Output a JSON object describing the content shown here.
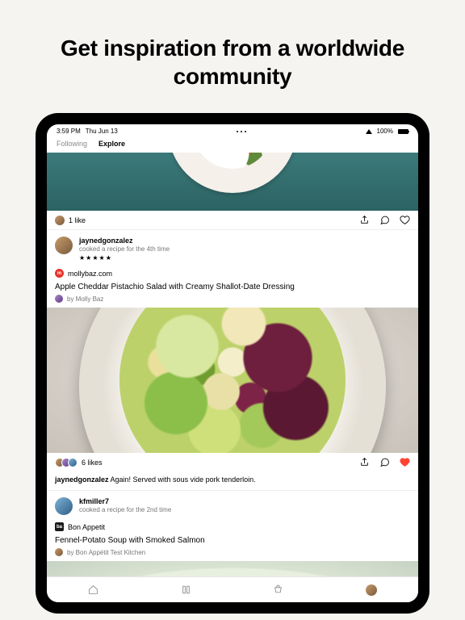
{
  "headline": "Get inspiration from a worldwide community",
  "statusbar": {
    "time": "3:59 PM",
    "date": "Thu Jun 13",
    "battery": "100%"
  },
  "tabs": {
    "following": "Following",
    "explore": "Explore",
    "active": "explore"
  },
  "post0": {
    "likes_text": "1 like"
  },
  "post1": {
    "user": "jaynedgonzalez",
    "subtitle": "cooked a recipe for the 4th time",
    "stars": "★★★★★",
    "source": "mollybaz.com",
    "title": "Apple Cheddar Pistachio Salad with Creamy Shallot-Date Dressing",
    "by_prefix": "by ",
    "by": "Molly Baz",
    "likes_text": "6 likes",
    "caption_user": "jaynedgonzalez",
    "caption_text": " Again! Served with sous vide pork tenderloin."
  },
  "post2": {
    "user": "kfmiller7",
    "subtitle": "cooked a recipe for the 2nd time",
    "source": "Bon Appetit",
    "title": "Fennel-Potato Soup with Smoked Salmon",
    "by_prefix": "by ",
    "by": "Bon Appétit Test Kitchen"
  }
}
